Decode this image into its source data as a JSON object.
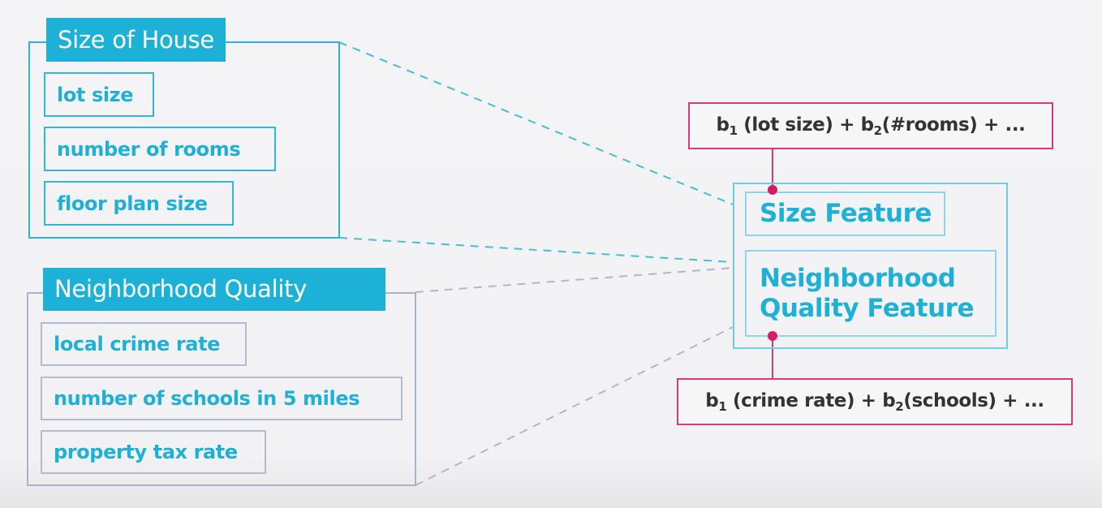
{
  "groups": [
    {
      "title": "Size of House",
      "items": [
        "lot size",
        "number of rooms",
        "floor plan size"
      ]
    },
    {
      "title": "Neighborhood Quality",
      "items": [
        "local crime rate",
        "number of schools in 5 miles",
        "property tax rate"
      ]
    }
  ],
  "features": [
    {
      "label": "Size Feature"
    },
    {
      "label_line1": "Neighborhood",
      "label_line2": "Quality Feature"
    }
  ],
  "formulas": [
    {
      "coef1": "b",
      "sub1": "1",
      "term1": " (lot size) + ",
      "coef2": "b",
      "sub2": "2",
      "term2": "(#rooms) + ..."
    },
    {
      "coef1": "b",
      "sub1": "1",
      "term1": " (crime rate) + ",
      "coef2": "b",
      "sub2": "2",
      "term2": "(schools) + ..."
    }
  ],
  "colors": {
    "accent_cyan": "#1db1d8",
    "secondary_gray_blue": "#a8b4cc",
    "formula_pink": "#d83b7c",
    "connector_dot": "#d81b64"
  }
}
